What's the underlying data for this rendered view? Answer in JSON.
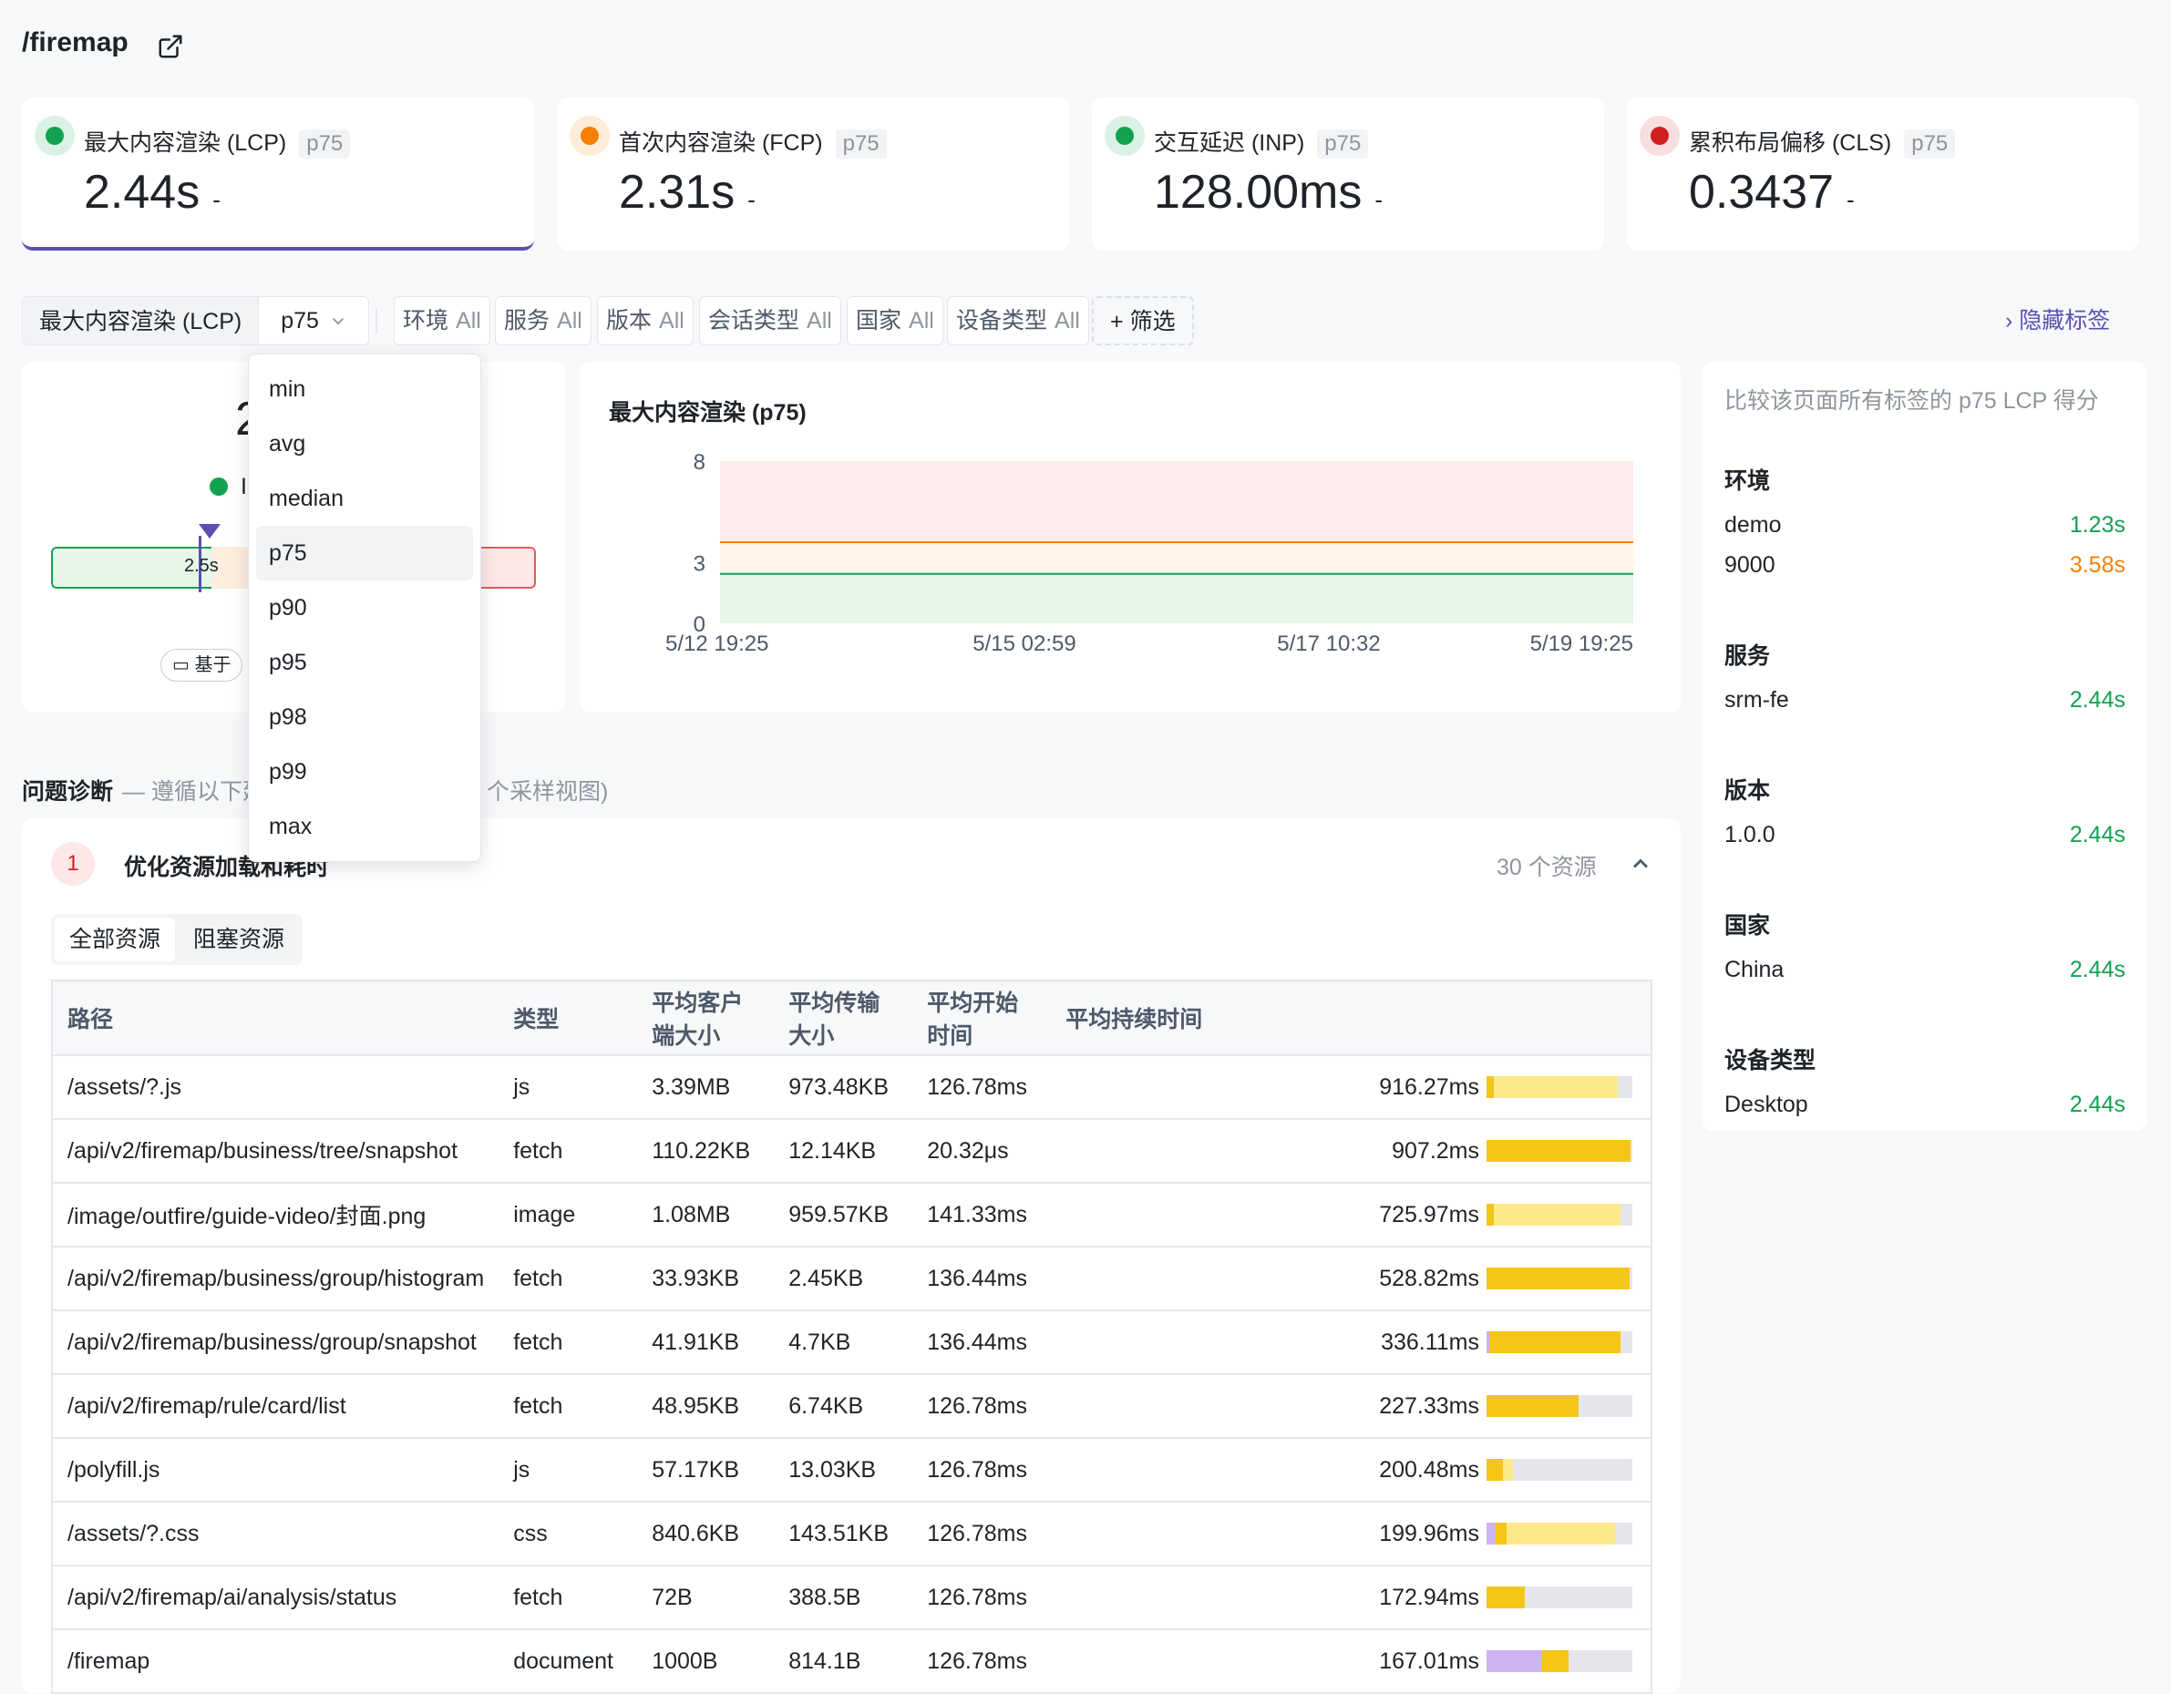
{
  "header": {
    "path": "/firemap",
    "open_icon": "external-link-icon"
  },
  "metrics": [
    {
      "name": "最大内容渲染 (LCP)",
      "stat": "p75",
      "value": "2.44s",
      "suffix": "-",
      "status_color": "#12a150"
    },
    {
      "name": "首次内容渲染 (FCP)",
      "stat": "p75",
      "value": "2.31s",
      "suffix": "-",
      "status_color": "#f77f00"
    },
    {
      "name": "交互延迟 (INP)",
      "stat": "p75",
      "value": "128.00ms",
      "suffix": "-",
      "status_color": "#12a150"
    },
    {
      "name": "累积布局偏移 (CLS)",
      "stat": "p75",
      "value": "0.3437",
      "suffix": "-",
      "status_color": "#d11f1f"
    }
  ],
  "filters": {
    "metric_select": "最大内容渲染 (LCP)",
    "stat_select": "p75",
    "chips": [
      {
        "label": "环境",
        "value": "All"
      },
      {
        "label": "服务",
        "value": "All"
      },
      {
        "label": "版本",
        "value": "All"
      },
      {
        "label": "会话类型",
        "value": "All"
      },
      {
        "label": "国家",
        "value": "All"
      },
      {
        "label": "设备类型",
        "value": "All"
      }
    ],
    "add_filter": "筛选",
    "hide_tags": "隐藏标签"
  },
  "dropdown": {
    "options": [
      "min",
      "avg",
      "median",
      "p75",
      "p90",
      "p95",
      "p98",
      "p99",
      "max"
    ],
    "selected": "p75"
  },
  "gauge": {
    "value_partial": "2",
    "status_partial": "I",
    "threshold_label": "2.5s",
    "basis_partial": "基于",
    "colors": {
      "good": "#e6f6e8",
      "needs": "#fdeee0",
      "poor": "#fde8e8"
    }
  },
  "chart": {
    "title": "最大内容渲染 (p75)"
  },
  "chart_data": {
    "type": "line",
    "title": "最大内容渲染 (p75)",
    "x_ticks": [
      "5/12 19:25",
      "5/15 02:59",
      "5/17 10:32",
      "5/19 19:25"
    ],
    "y_ticks": [
      "8",
      "3",
      "0"
    ],
    "ylim": [
      0,
      8
    ],
    "bands": [
      {
        "name": "good",
        "from": 0,
        "to": 2.5,
        "color": "#e6f6e8"
      },
      {
        "name": "needs-improvement",
        "from": 2.5,
        "to": 4,
        "color": "#fff4e6"
      },
      {
        "name": "poor",
        "from": 4,
        "to": 8,
        "color": "#fdecec"
      }
    ],
    "series": [
      {
        "values_x": [
          "5/12 19:25",
          "5/19 19:25"
        ],
        "values_y": [
          2.44,
          2.44
        ],
        "color": "#12a150"
      },
      {
        "values_x": [
          "5/12 19:25",
          "5/19 19:25"
        ],
        "values_y": [
          4,
          4
        ],
        "color": "#f77f00"
      }
    ]
  },
  "tags": {
    "description": "比较该页面所有标签的 p75 LCP 得分",
    "groups": [
      {
        "name": "环境",
        "rows": [
          {
            "label": "demo",
            "value": "1.23s",
            "color": "#12a150"
          },
          {
            "label": "9000",
            "value": "3.58s",
            "color": "#f77f00"
          }
        ]
      },
      {
        "name": "服务",
        "rows": [
          {
            "label": "srm-fe",
            "value": "2.44s",
            "color": "#12a150"
          }
        ]
      },
      {
        "name": "版本",
        "rows": [
          {
            "label": "1.0.0",
            "value": "2.44s",
            "color": "#12a150"
          }
        ]
      },
      {
        "name": "国家",
        "rows": [
          {
            "label": "China",
            "value": "2.44s",
            "color": "#12a150"
          }
        ]
      },
      {
        "name": "设备类型",
        "rows": [
          {
            "label": "Desktop",
            "value": "2.44s",
            "color": "#12a150"
          }
        ]
      }
    ]
  },
  "diagnosis": {
    "title": "问题诊断",
    "hint_left": "— 遵循以下建",
    "hint_right": "个采样视图)",
    "item_number": "1",
    "item_title": "优化资源加载和耗时",
    "resource_count": "30 个资源",
    "tabs": [
      "全部资源",
      "阻塞资源"
    ],
    "active_tab": 0,
    "columns": [
      "路径",
      "类型",
      "平均客户端大小",
      "平均传输大小",
      "平均开始时间",
      "平均持续时间"
    ],
    "rows": [
      {
        "path": "/assets/?.js",
        "type": "js",
        "client": "3.39MB",
        "transfer": "973.48KB",
        "start": "126.78ms",
        "duration": "916.27ms",
        "bar": [
          {
            "from": 0,
            "to": 0.05,
            "color": "#f5c518"
          },
          {
            "from": 0.05,
            "to": 0.9,
            "color": "#fde98a"
          }
        ]
      },
      {
        "path": "/api/v2/firemap/business/tree/snapshot",
        "type": "fetch",
        "client": "110.22KB",
        "transfer": "12.14KB",
        "start": "20.32μs",
        "duration": "907.2ms",
        "bar": [
          {
            "from": 0,
            "to": 0.99,
            "color": "#f5c518"
          }
        ]
      },
      {
        "path": "/image/outfire/guide-video/封面.png",
        "type": "image",
        "client": "1.08MB",
        "transfer": "959.57KB",
        "start": "141.33ms",
        "duration": "725.97ms",
        "bar": [
          {
            "from": 0,
            "to": 0.05,
            "color": "#f5c518"
          },
          {
            "from": 0.05,
            "to": 0.92,
            "color": "#fde98a"
          }
        ]
      },
      {
        "path": "/api/v2/firemap/business/group/histogram",
        "type": "fetch",
        "client": "33.93KB",
        "transfer": "2.45KB",
        "start": "136.44ms",
        "duration": "528.82ms",
        "bar": [
          {
            "from": 0,
            "to": 0.98,
            "color": "#f5c518"
          }
        ]
      },
      {
        "path": "/api/v2/firemap/business/group/snapshot",
        "type": "fetch",
        "client": "41.91KB",
        "transfer": "4.7KB",
        "start": "136.44ms",
        "duration": "336.11ms",
        "bar": [
          {
            "from": 0,
            "to": 0.02,
            "color": "#cdb3f0"
          },
          {
            "from": 0.02,
            "to": 0.92,
            "color": "#f5c518"
          }
        ]
      },
      {
        "path": "/api/v2/firemap/rule/card/list",
        "type": "fetch",
        "client": "48.95KB",
        "transfer": "6.74KB",
        "start": "126.78ms",
        "duration": "227.33ms",
        "bar": [
          {
            "from": 0,
            "to": 0.63,
            "color": "#f5c518"
          }
        ]
      },
      {
        "path": "/polyfill.js",
        "type": "js",
        "client": "57.17KB",
        "transfer": "13.03KB",
        "start": "126.78ms",
        "duration": "200.48ms",
        "bar": [
          {
            "from": 0,
            "to": 0.11,
            "color": "#f5c518"
          },
          {
            "from": 0.11,
            "to": 0.18,
            "color": "#fde98a"
          }
        ]
      },
      {
        "path": "/assets/?.css",
        "type": "css",
        "client": "840.6KB",
        "transfer": "143.51KB",
        "start": "126.78ms",
        "duration": "199.96ms",
        "bar": [
          {
            "from": 0,
            "to": 0.06,
            "color": "#cdb3f0"
          },
          {
            "from": 0.06,
            "to": 0.14,
            "color": "#f5c518"
          },
          {
            "from": 0.14,
            "to": 0.88,
            "color": "#fde98a"
          }
        ]
      },
      {
        "path": "/api/v2/firemap/ai/analysis/status",
        "type": "fetch",
        "client": "72B",
        "transfer": "388.5B",
        "start": "126.78ms",
        "duration": "172.94ms",
        "bar": [
          {
            "from": 0,
            "to": 0.26,
            "color": "#f5c518"
          }
        ]
      },
      {
        "path": "/firemap",
        "type": "document",
        "client": "1000B",
        "transfer": "814.1B",
        "start": "126.78ms",
        "duration": "167.01ms",
        "bar": [
          {
            "from": 0,
            "to": 0.38,
            "color": "#cdb3f0"
          },
          {
            "from": 0.38,
            "to": 0.56,
            "color": "#f5c518"
          }
        ]
      }
    ]
  }
}
